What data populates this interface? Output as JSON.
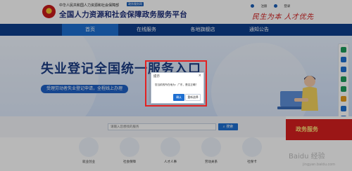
{
  "header": {
    "org_line": "中华人民共和国人力资源和社会保障部",
    "org_tag": "政务服务网",
    "platform_title": "全国人力资源和社会保障政务服务平台",
    "util_links": [
      "注册",
      "登录"
    ],
    "slogan": "民生为本 人才优先"
  },
  "nav": {
    "items": [
      {
        "label": "首页",
        "active": true
      },
      {
        "label": "在线服务",
        "active": false
      },
      {
        "label": "各地旗舰店",
        "active": false
      },
      {
        "label": "通知公告",
        "active": false
      }
    ]
  },
  "hero": {
    "title": "失业登记全国统一服务入口",
    "subtitle": "受理劳动者失业登记申请，全程线上办理"
  },
  "search": {
    "placeholder": "请输入您想找的服务",
    "button_label": "搜索"
  },
  "services": [
    {
      "label": "就业创业",
      "icon": "employment-icon"
    },
    {
      "label": "社会保障",
      "icon": "social-security-icon"
    },
    {
      "label": "人才人事",
      "icon": "talent-icon"
    },
    {
      "label": "劳动关系",
      "icon": "labor-relations-icon"
    },
    {
      "label": "社保卡",
      "icon": "social-card-icon"
    }
  ],
  "promo": {
    "text": "政务服务"
  },
  "watermark": {
    "brand": "Baidu 经验",
    "url": "jingyan.baidu.com"
  },
  "dialog": {
    "title": "提示",
    "message": "您当前的所在地为：广东，是否正确？",
    "confirm_label": "确认",
    "reselect_label": "重新选择"
  },
  "colors": {
    "nav_bg": "#0e3f8c",
    "accent": "#1e6fd1",
    "highlight": "#e32222"
  }
}
